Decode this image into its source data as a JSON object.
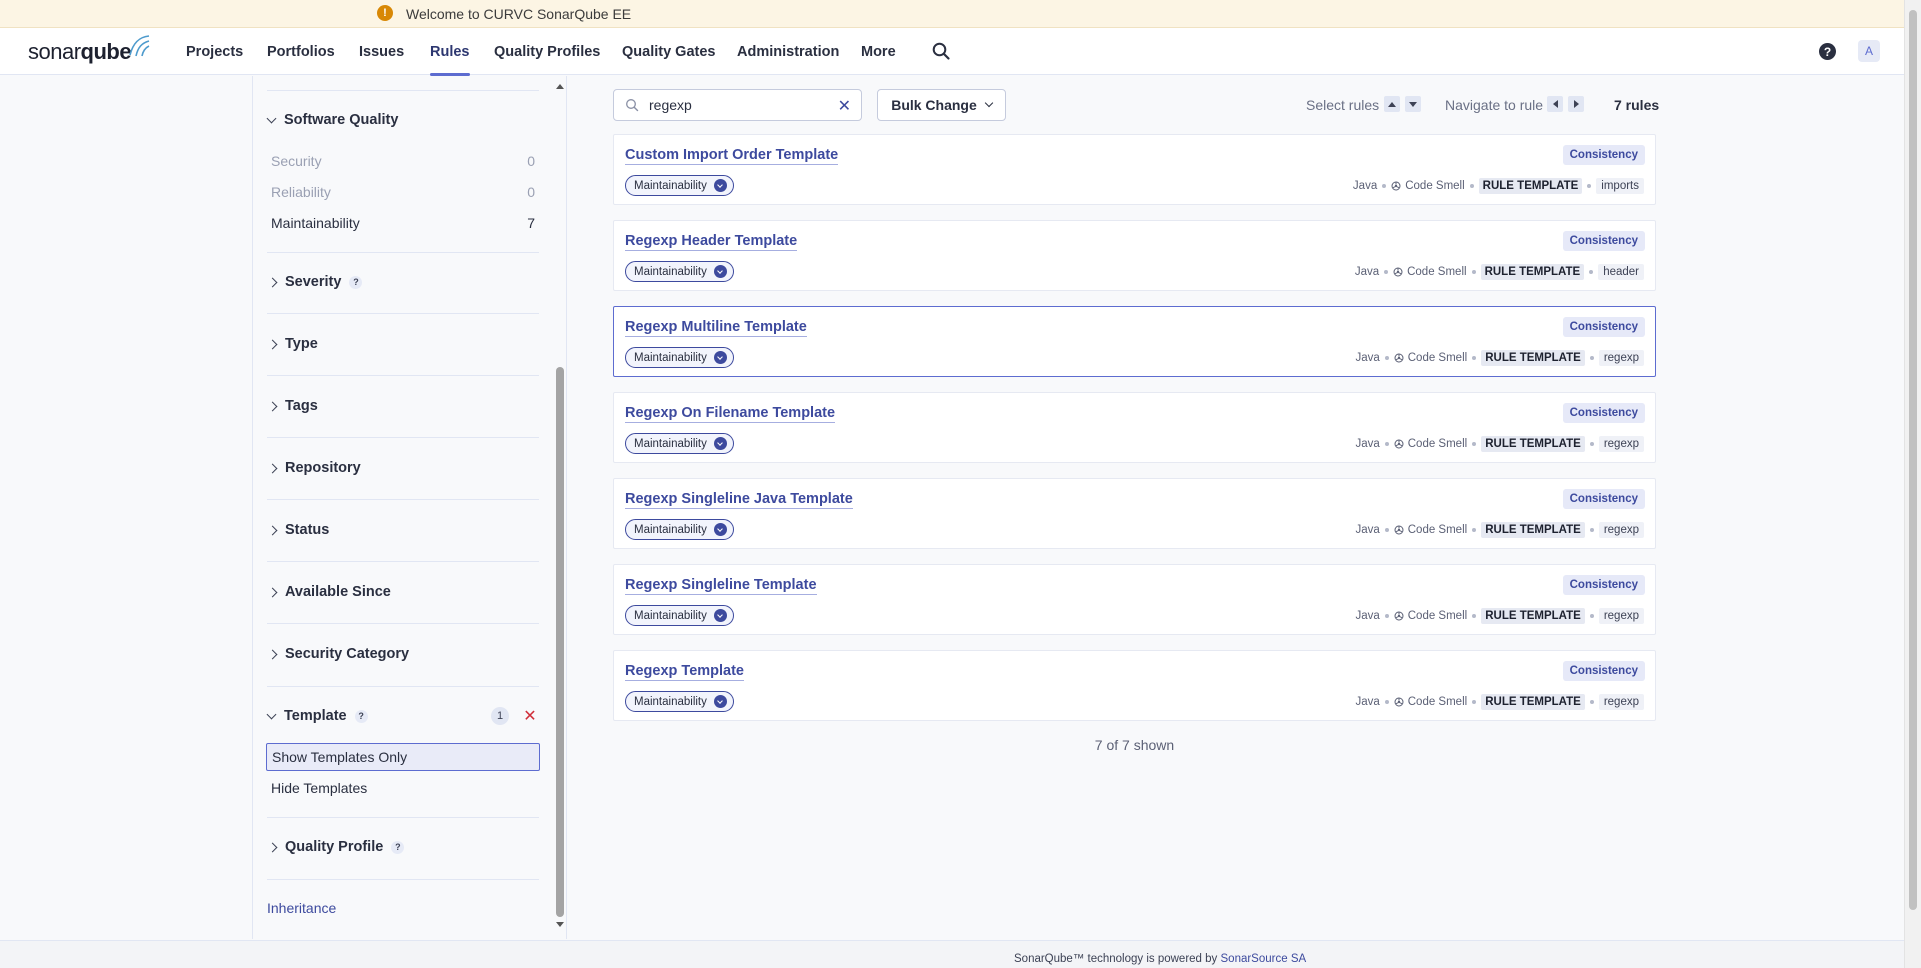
{
  "banner": {
    "icon": "warning-icon",
    "text": "Welcome to CURVC SonarQube EE"
  },
  "nav": {
    "logo_part1": "sonar",
    "logo_part2": "qube",
    "items": [
      {
        "label": "Projects"
      },
      {
        "label": "Portfolios"
      },
      {
        "label": "Issues"
      },
      {
        "label": "Rules"
      },
      {
        "label": "Quality Profiles"
      },
      {
        "label": "Quality Gates"
      },
      {
        "label": "Administration"
      },
      {
        "label": "More"
      }
    ],
    "active": "Rules",
    "help": "?",
    "avatar": "A"
  },
  "sidebar": {
    "software_quality": {
      "title": "Software Quality",
      "items": [
        {
          "label": "Security",
          "count": "0"
        },
        {
          "label": "Reliability",
          "count": "0"
        },
        {
          "label": "Maintainability",
          "count": "7"
        }
      ]
    },
    "facets": [
      {
        "label": "Severity"
      },
      {
        "label": "Type"
      },
      {
        "label": "Tags"
      },
      {
        "label": "Repository"
      },
      {
        "label": "Status"
      },
      {
        "label": "Available Since"
      },
      {
        "label": "Security Category"
      }
    ],
    "template": {
      "title": "Template",
      "count": "1",
      "clear": "✕",
      "options": [
        {
          "label": "Show Templates Only"
        },
        {
          "label": "Hide Templates"
        }
      ]
    },
    "quality_profile": {
      "title": "Quality Profile"
    },
    "inheritance": "Inheritance"
  },
  "toolbar": {
    "search_value": "regexp",
    "bulk_label": "Bulk Change",
    "select_rules": "Select rules",
    "navigate_to_rule": "Navigate to rule",
    "rules_count": "7 rules"
  },
  "rules": [
    {
      "title": "Custom Import Order Template",
      "badge": "Consistency",
      "quality": "Maintainability",
      "lang": "Java",
      "type": "Code Smell",
      "template": "RULE TEMPLATE",
      "tag": "imports"
    },
    {
      "title": "Regexp Header Template",
      "badge": "Consistency",
      "quality": "Maintainability",
      "lang": "Java",
      "type": "Code Smell",
      "template": "RULE TEMPLATE",
      "tag": "header"
    },
    {
      "title": "Regexp Multiline Template",
      "badge": "Consistency",
      "quality": "Maintainability",
      "lang": "Java",
      "type": "Code Smell",
      "template": "RULE TEMPLATE",
      "tag": "regexp"
    },
    {
      "title": "Regexp On Filename Template",
      "badge": "Consistency",
      "quality": "Maintainability",
      "lang": "Java",
      "type": "Code Smell",
      "template": "RULE TEMPLATE",
      "tag": "regexp"
    },
    {
      "title": "Regexp Singleline Java Template",
      "badge": "Consistency",
      "quality": "Maintainability",
      "lang": "Java",
      "type": "Code Smell",
      "template": "RULE TEMPLATE",
      "tag": "regexp"
    },
    {
      "title": "Regexp Singleline Template",
      "badge": "Consistency",
      "quality": "Maintainability",
      "lang": "Java",
      "type": "Code Smell",
      "template": "RULE TEMPLATE",
      "tag": "regexp"
    },
    {
      "title": "Regexp Template",
      "badge": "Consistency",
      "quality": "Maintainability",
      "lang": "Java",
      "type": "Code Smell",
      "template": "RULE TEMPLATE",
      "tag": "regexp"
    }
  ],
  "shown": "7 of 7 shown",
  "footer": {
    "text": "SonarQube™ technology is powered by",
    "link": "SonarSource SA"
  },
  "colors": {
    "accent": "#5d6cd0",
    "link": "#3d4a9e",
    "banner_bg": "#fcf5e4",
    "warning": "#d88805",
    "danger": "#d02f3a"
  }
}
